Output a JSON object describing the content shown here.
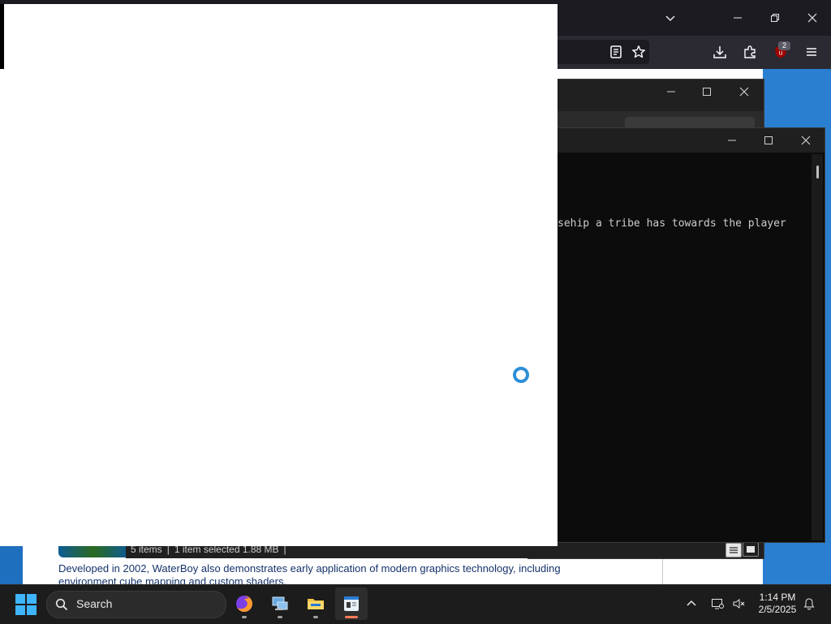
{
  "firefox": {
    "toolbar_icons": [
      "reader-view-icon",
      "star-icon",
      "download-icon",
      "extensions-icon",
      "ublock-icon",
      "menu-icon"
    ],
    "ext_badge": "2",
    "window_controls": [
      "list-all-tabs-icon",
      "minimize-icon",
      "restore-icon",
      "close-icon"
    ]
  },
  "page": {
    "text": "Developed in 2002, WaterBoy also demonstrates early application of modern graphics technology, including environment cube mapping and custom shaders."
  },
  "explorer": {
    "status": {
      "items": "5 items",
      "selected": "1 item selected  1.88 MB"
    },
    "view_buttons": [
      "details-view-icon",
      "tiles-view-icon"
    ]
  },
  "terminal": {
    "line": "sehip a tribe has towards the player"
  },
  "taskbar": {
    "search_label": "Search",
    "apps": [
      "firefox-icon",
      "network-computer-icon",
      "file-explorer-icon",
      "notepad-app-icon"
    ],
    "tray": [
      "chevron-up-icon",
      "network-icon",
      "volume-muted-icon",
      "notifications-icon"
    ],
    "time": "1:14 PM",
    "date": "2/5/2025"
  },
  "colors": {
    "taskbar_bg": "#1c1c1c",
    "spinner": "#2d8fd6",
    "accent_dot": "#ff7a59"
  }
}
